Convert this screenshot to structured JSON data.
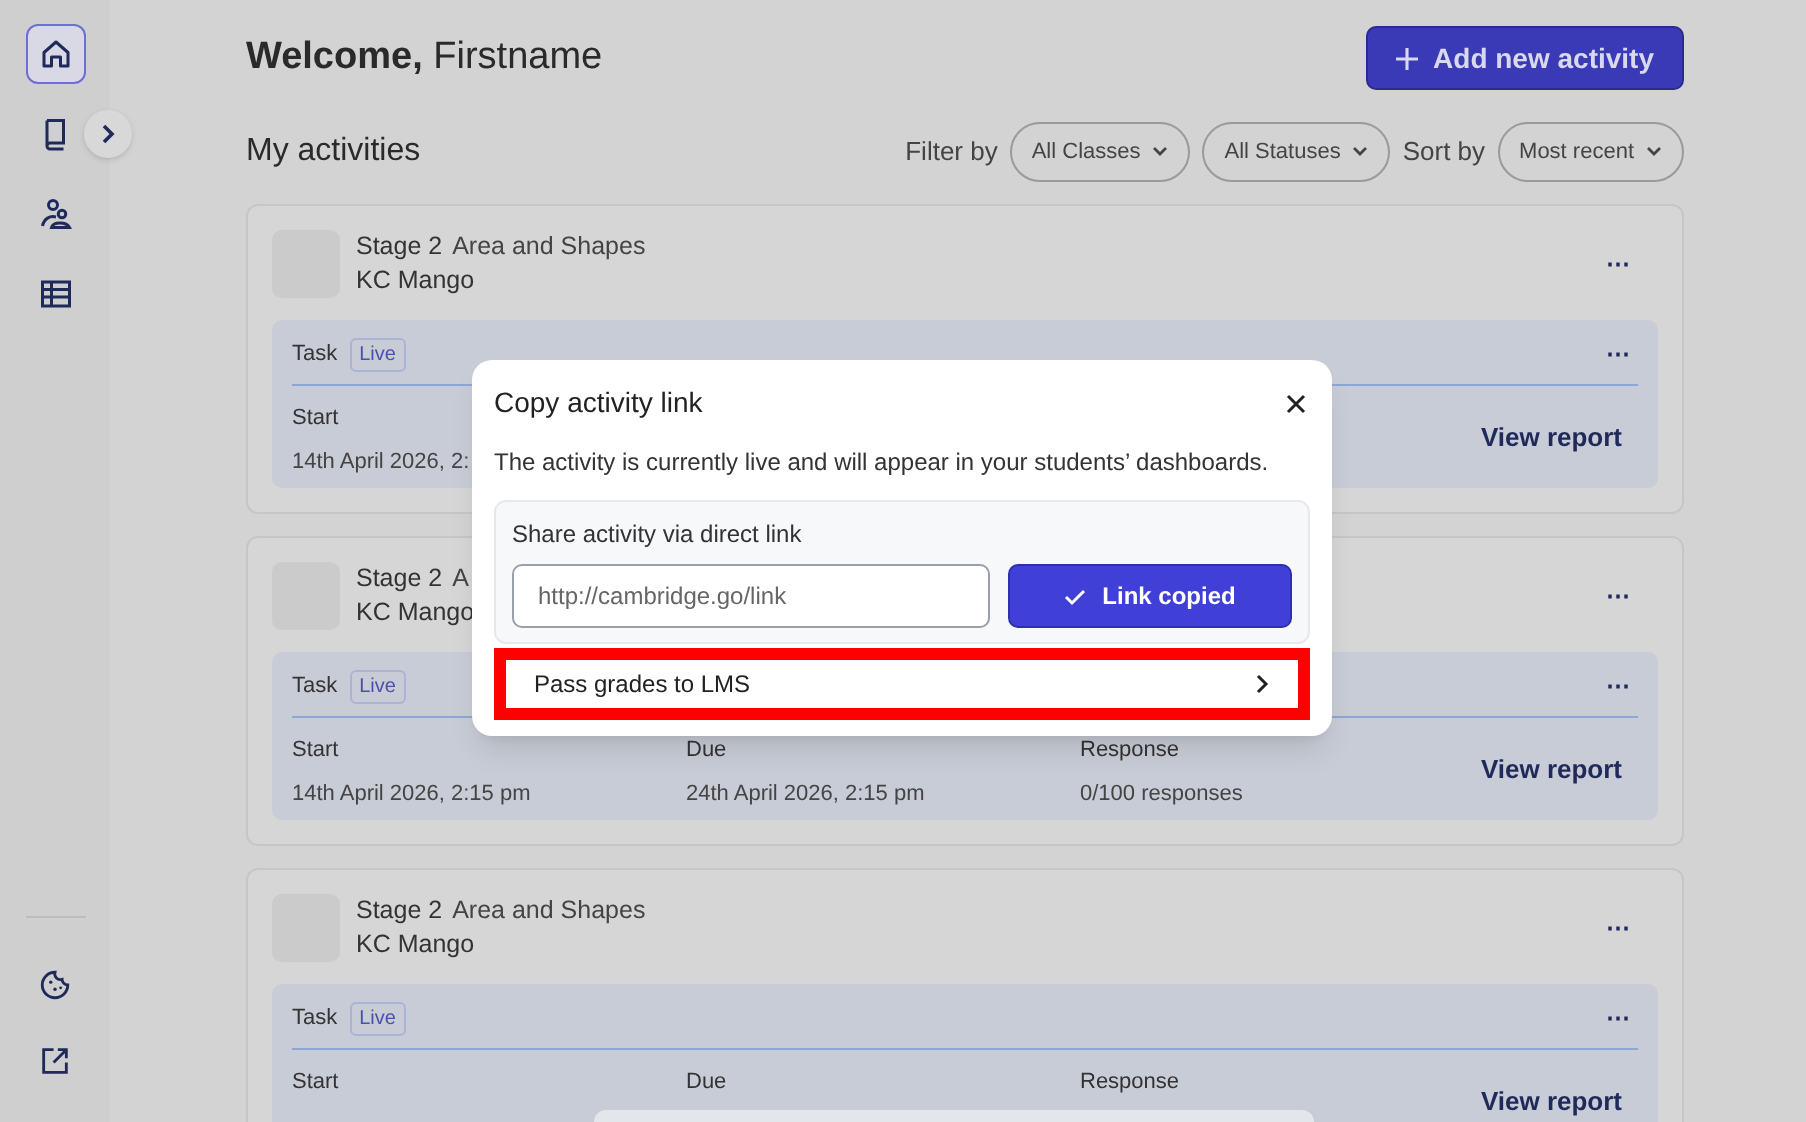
{
  "sidebar": {
    "items": [
      {
        "selected": true
      },
      {
        "selected": false
      },
      {
        "selected": false
      },
      {
        "selected": false
      }
    ],
    "bottom_items": [
      {
        "selected": false
      },
      {
        "selected": false
      }
    ]
  },
  "header": {
    "title": "**Welcome,** Firstname",
    "add_button": "Add new activity"
  },
  "toolbar": {
    "section_title": "My activities",
    "filter_label": "Filter by",
    "filters": [
      "All Classes",
      "All Statuses"
    ],
    "sort_label": "Sort by",
    "sort": "Most recent"
  },
  "cards": [
    {
      "stage": "Stage 2",
      "subject": "Area and Shapes",
      "class": "KC Mango",
      "menu": "⋯",
      "task_label": "Task",
      "status": "Live",
      "task_menu": "⋯",
      "fields": [
        {
          "label": "Start",
          "value": "14th April 2026, 2:"
        }
      ],
      "link": "View report"
    },
    {
      "stage": "Stage 2",
      "subject": "A",
      "class": "KC Mango",
      "menu": "⋯",
      "task_label": "Task",
      "status": "Live",
      "task_menu": "⋯",
      "fields": [
        {
          "label": "Start",
          "value": "14th April 2026, 2:15 pm"
        },
        {
          "label": "Due",
          "value": "24th April 2026, 2:15 pm"
        },
        {
          "label": "Response",
          "value": "0/100 responses"
        }
      ],
      "link": "View report"
    },
    {
      "stage": "Stage 2",
      "subject": "Area and Shapes",
      "class": "KC Mango",
      "menu": "⋯",
      "task_label": "Task",
      "status": "Live",
      "task_menu": "⋯",
      "fields": [
        {
          "label": "Start"
        },
        {
          "label": "Due"
        },
        {
          "label": "Response"
        }
      ],
      "link": "View report"
    }
  ],
  "modal": {
    "title": "Copy activity link",
    "message": "The activity is currently live and will appear in your students’ dashboards.",
    "share_label": "Share activity via direct link",
    "link_value": "http://cambridge.go/link",
    "copy_button": "Link copied",
    "option": "Pass grades to LMS",
    "highlighted": true
  }
}
